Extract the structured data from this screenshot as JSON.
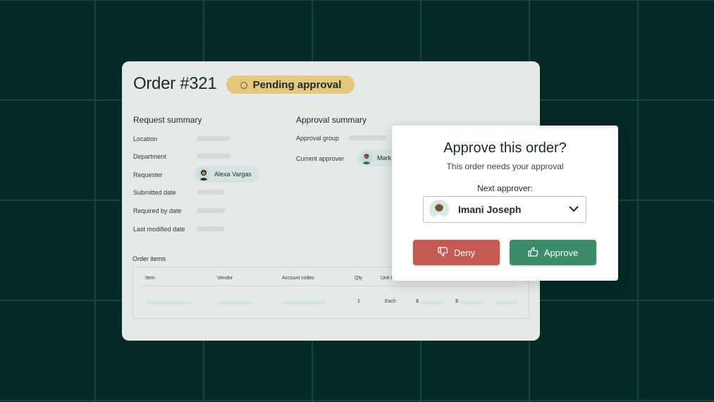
{
  "order": {
    "title": "Order #321",
    "status": "Pending approval",
    "request_summary": {
      "heading": "Request summary",
      "fields": {
        "location": "Location",
        "department": "Department",
        "requester": "Requester",
        "submitted_date": "Submitted date",
        "required_by_date": "Required by date",
        "last_modified_date": "Last modified date"
      },
      "requester_name": "Alexa Vargas"
    },
    "approval_summary": {
      "heading": "Approval summary",
      "fields": {
        "approval_group": "Approval group",
        "current_approver": "Current approver"
      },
      "current_approver_name": "Mark"
    },
    "items": {
      "heading": "Order items",
      "columns": [
        "Item",
        "Vendor",
        "Account codes",
        "Qty",
        "Unit t"
      ],
      "row": {
        "qty": "1",
        "unit": "Each",
        "currency_1": "$",
        "currency_2": "$"
      }
    }
  },
  "dialog": {
    "title": "Approve this order?",
    "subtitle": "This order needs your approval",
    "next_approver_label": "Next approver:",
    "selected_approver": "Imani Joseph",
    "deny_label": "Deny",
    "approve_label": "Approve"
  },
  "colors": {
    "background": "#052a26",
    "status_badge": "#e5c87e",
    "deny": "#c55a52",
    "approve": "#3b8c68"
  },
  "icons": [
    "spinner-icon",
    "chevron-down-icon",
    "thumbs-down-icon",
    "thumbs-up-icon",
    "avatar"
  ]
}
